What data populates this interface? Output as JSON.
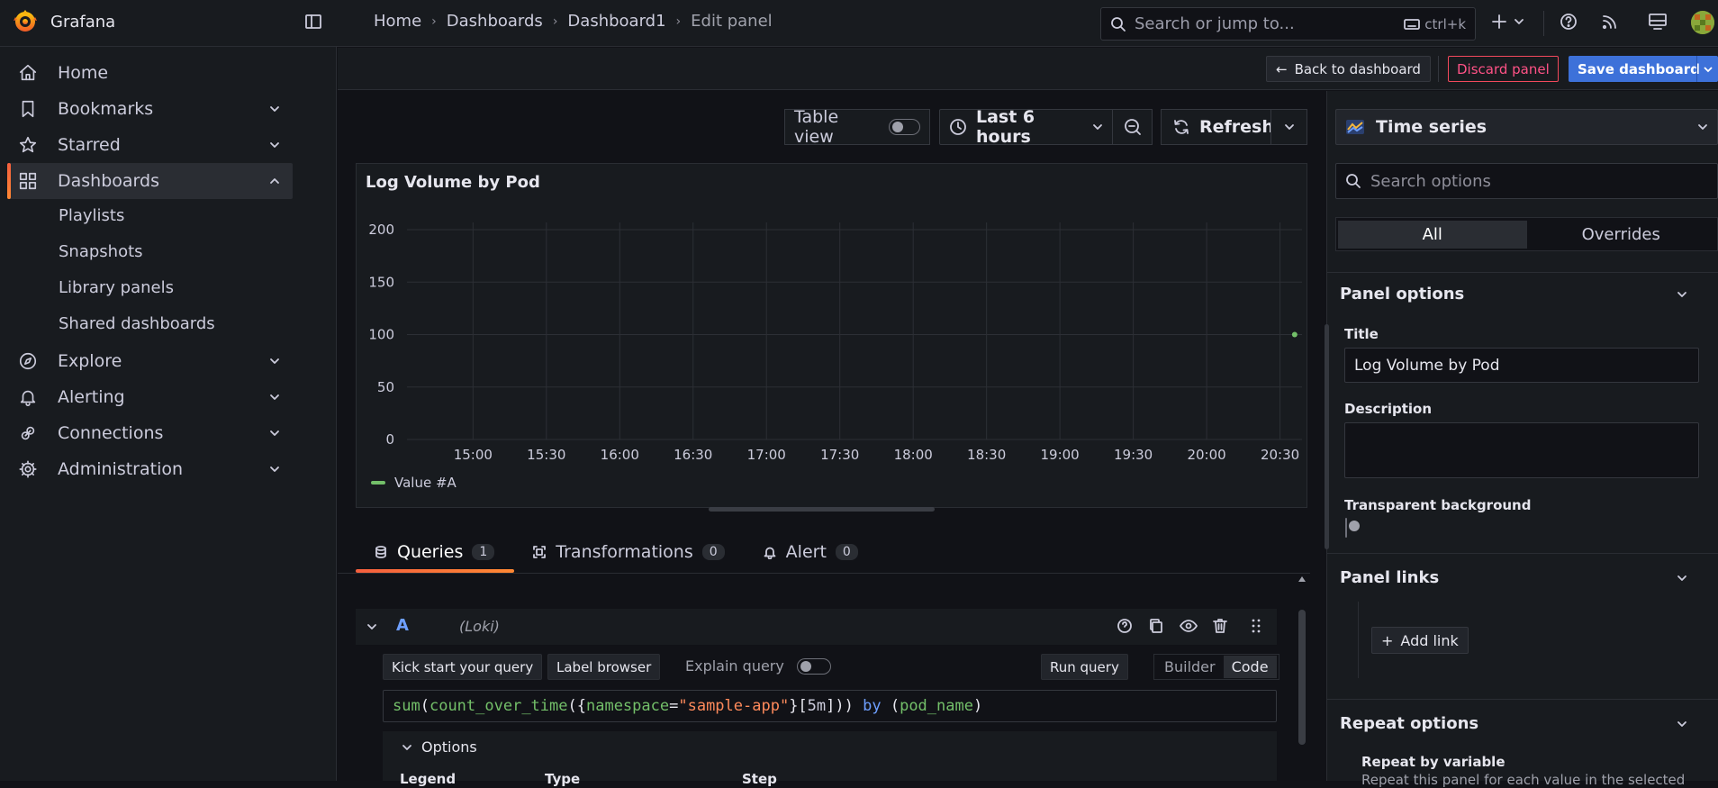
{
  "app": {
    "name": "Grafana"
  },
  "breadcrumb": [
    "Home",
    "Dashboards",
    "Dashboard1",
    "Edit panel"
  ],
  "search": {
    "placeholder": "Search or jump to...",
    "shortcut": "ctrl+k"
  },
  "sidebar": {
    "items": [
      {
        "label": "Home",
        "icon": "home-icon"
      },
      {
        "label": "Bookmarks",
        "icon": "bookmark-icon"
      },
      {
        "label": "Starred",
        "icon": "star-icon"
      },
      {
        "label": "Dashboards",
        "icon": "apps-icon",
        "active": true
      },
      {
        "label": "Explore",
        "icon": "compass-icon"
      },
      {
        "label": "Alerting",
        "icon": "bell-icon"
      },
      {
        "label": "Connections",
        "icon": "link-icon"
      },
      {
        "label": "Administration",
        "icon": "cog-icon"
      }
    ],
    "subitems": [
      "Playlists",
      "Snapshots",
      "Library panels",
      "Shared dashboards"
    ]
  },
  "toolbar": {
    "back": "Back to dashboard",
    "discard": "Discard panel",
    "save": "Save dashboard",
    "table_view": "Table view",
    "time_range": "Last 6 hours",
    "refresh": "Refresh"
  },
  "panel": {
    "title": "Log Volume by Pod"
  },
  "chart_data": {
    "type": "line",
    "title": "Log Volume by Pod",
    "x_ticks": [
      "15:00",
      "15:30",
      "16:00",
      "16:30",
      "17:00",
      "17:30",
      "18:00",
      "18:30",
      "19:00",
      "19:30",
      "20:00",
      "20:30"
    ],
    "y_ticks": [
      0,
      50,
      100,
      150,
      200
    ],
    "ylim": [
      0,
      200
    ],
    "series": [
      {
        "name": "Value #A",
        "color": "#73bf69",
        "points": [
          {
            "x": "20:36",
            "y": 100
          }
        ]
      }
    ],
    "legend": "bottom-left",
    "grid": true
  },
  "tabs": [
    {
      "label": "Queries",
      "count": "1",
      "icon": "database-icon",
      "active": true
    },
    {
      "label": "Transformations",
      "count": "0",
      "icon": "transform-icon"
    },
    {
      "label": "Alert",
      "count": "0",
      "icon": "bell-icon"
    }
  ],
  "query": {
    "ref": "A",
    "datasource": "(Loki)",
    "kick_start": "Kick start your query",
    "label_browser": "Label browser",
    "explain": "Explain query",
    "run": "Run query",
    "modes": [
      "Builder",
      "Code"
    ],
    "mode_selected": "Code",
    "expr_tokens": [
      {
        "t": "sum",
        "c": "tk-fn"
      },
      {
        "t": "(",
        "c": "tk-p"
      },
      {
        "t": "count_over_time",
        "c": "tk-fn"
      },
      {
        "t": "({",
        "c": "tk-p"
      },
      {
        "t": "namespace",
        "c": "tk-l"
      },
      {
        "t": "=",
        "c": "tk-p"
      },
      {
        "t": "\"sample-app\"",
        "c": "tk-s"
      },
      {
        "t": "}[",
        "c": "tk-p"
      },
      {
        "t": "5m",
        "c": "tk-d"
      },
      {
        "t": "])) ",
        "c": "tk-p"
      },
      {
        "t": "by",
        "c": "tk-k"
      },
      {
        "t": " (",
        "c": "tk-p"
      },
      {
        "t": "pod_name",
        "c": "tk-l"
      },
      {
        "t": ")",
        "c": "tk-p"
      }
    ],
    "options_label": "Options",
    "option_cols": [
      "Legend",
      "Type",
      "Step"
    ]
  },
  "right": {
    "viz": "Time series",
    "search_placeholder": "Search options",
    "segments": [
      "All",
      "Overrides"
    ],
    "panel_options": "Panel options",
    "title_label": "Title",
    "title_value": "Log Volume by Pod",
    "desc_label": "Description",
    "transparent_label": "Transparent background",
    "panel_links": "Panel links",
    "add_link": "Add link",
    "repeat_options": "Repeat options",
    "repeat_by": "Repeat by variable",
    "repeat_desc": "Repeat this panel for each value in the selected"
  }
}
